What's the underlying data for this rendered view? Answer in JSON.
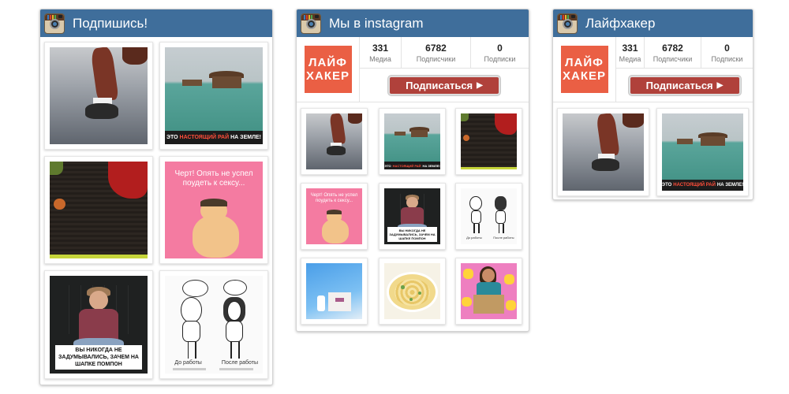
{
  "widgets": {
    "left": {
      "title": "Подпишись!"
    },
    "middle": {
      "title": "Мы в instagram",
      "logo": [
        "ЛАЙФ",
        "ХАКЕР"
      ],
      "stats": [
        {
          "value": "331",
          "label": "Медиа"
        },
        {
          "value": "6782",
          "label": "Подписчики"
        },
        {
          "value": "0",
          "label": "Подписки"
        }
      ],
      "subscribe_label": "Подписаться",
      "subscribe_arrow": "▶"
    },
    "right": {
      "title": "Лайфхакер",
      "logo": [
        "ЛАЙФ",
        "ХАКЕР"
      ],
      "stats": [
        {
          "value": "331",
          "label": "Медиа"
        },
        {
          "value": "6782",
          "label": "Подписчики"
        },
        {
          "value": "0",
          "label": "Подписки"
        }
      ],
      "subscribe_label": "Подписаться",
      "subscribe_arrow": "▶"
    }
  },
  "photos": {
    "sea_caption": {
      "pre": "ЭТО",
      "highlight": "НАСТОЯЩИЙ РАЙ",
      "post": "НА ЗЕМЛЕ!"
    },
    "pink_text": "Черт! Опять не успел поудеть к сексу...",
    "woman_caption": "ВЫ НИКОГДА НЕ ЗАДУМЫВАЛИСЬ, ЗАЧЕМ НА ШАПКЕ ПОМПОН",
    "sketch_before": "До работы",
    "sketch_after": "После работы"
  },
  "colors": {
    "header": "#3f6e9b",
    "logo": "#ea5f44",
    "button": "#b0413b"
  },
  "icons": {
    "header": "instagram-camera-icon",
    "button": "play-arrow-icon"
  }
}
